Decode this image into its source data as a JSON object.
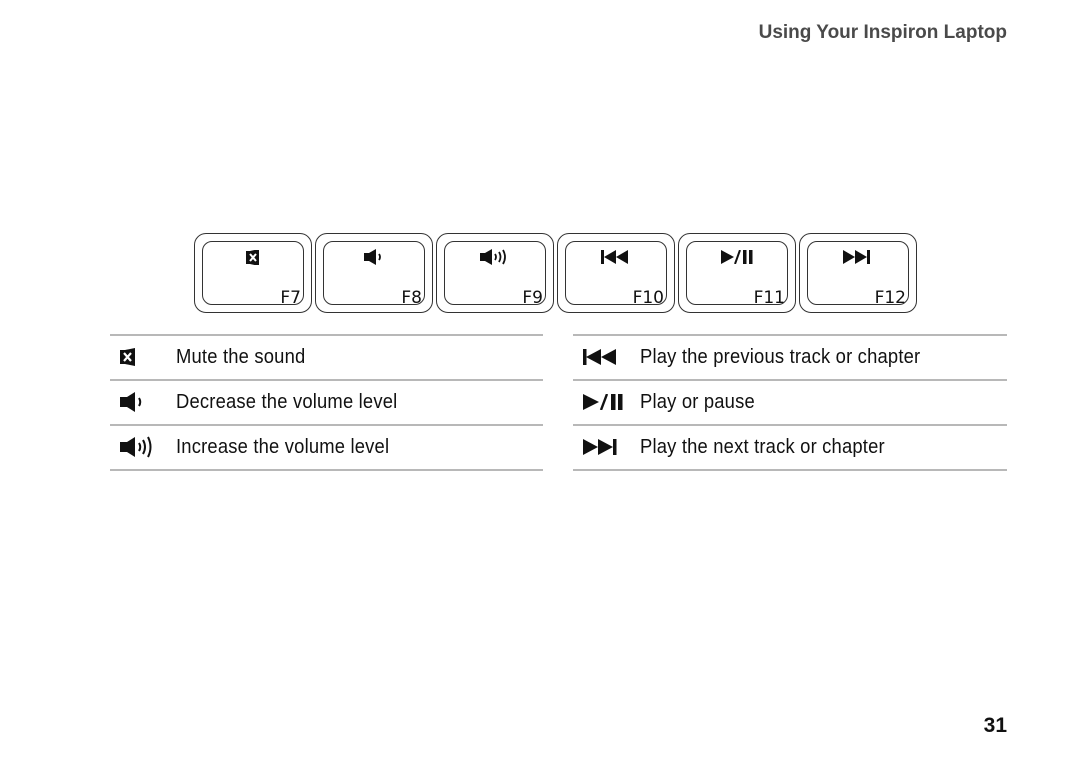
{
  "header": {
    "title": "Using Your Inspiron Laptop"
  },
  "keys": [
    {
      "label": "F7",
      "icon": "mute-icon"
    },
    {
      "label": "F8",
      "icon": "volume-down-icon"
    },
    {
      "label": "F9",
      "icon": "volume-up-icon"
    },
    {
      "label": "F10",
      "icon": "previous-track-icon"
    },
    {
      "label": "F11",
      "icon": "play-pause-icon"
    },
    {
      "label": "F12",
      "icon": "next-track-icon"
    }
  ],
  "legend_left": [
    {
      "icon": "mute-icon",
      "text": "Mute the sound"
    },
    {
      "icon": "volume-down-icon",
      "text": "Decrease the volume level"
    },
    {
      "icon": "volume-up-icon",
      "text": "Increase the volume level"
    }
  ],
  "legend_right": [
    {
      "icon": "previous-track-icon",
      "text": "Play the previous track or chapter"
    },
    {
      "icon": "play-pause-icon",
      "text": "Play or pause"
    },
    {
      "icon": "next-track-icon",
      "text": "Play the next track or chapter"
    }
  ],
  "page": {
    "number": "31"
  },
  "colors": {
    "header": "#4a4a4a",
    "rule": "#b8b8b8",
    "ink": "#111111"
  }
}
